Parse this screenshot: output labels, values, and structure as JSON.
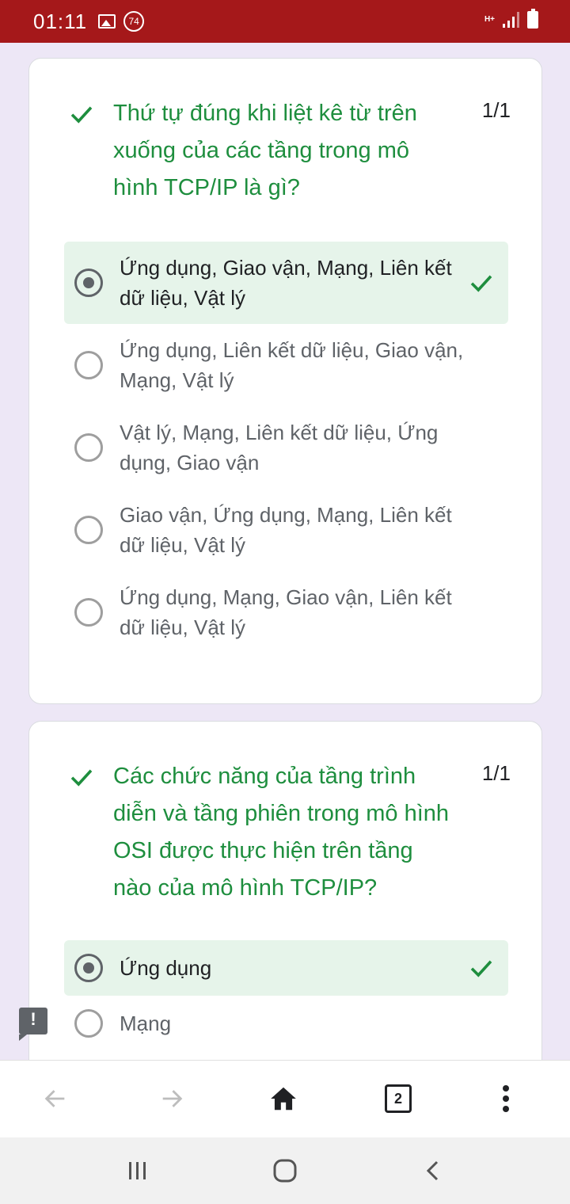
{
  "status_bar": {
    "time": "01:11",
    "notification_badge": "74",
    "network_type": "H+",
    "icons": [
      "image-icon",
      "counter-badge-icon",
      "network-type-icon",
      "signal-icon",
      "battery-icon"
    ]
  },
  "questions": [
    {
      "text": "Thứ tự đúng khi liệt kê từ trên xuống của các tầng trong mô hình TCP/IP là gì?",
      "score": "1/1",
      "options": [
        {
          "label": "Ứng dụng, Giao vận, Mạng, Liên kết dữ liệu, Vật lý",
          "selected": true,
          "correct": true
        },
        {
          "label": "Ứng dụng, Liên kết dữ liệu, Giao vận, Mạng, Vật lý",
          "selected": false,
          "correct": false
        },
        {
          "label": "Vật lý, Mạng, Liên kết dữ liệu, Ứng dụng, Giao vận",
          "selected": false,
          "correct": false
        },
        {
          "label": "Giao vận, Ứng dụng, Mạng, Liên kết dữ liệu, Vật lý",
          "selected": false,
          "correct": false
        },
        {
          "label": "Ứng dụng, Mạng, Giao vận, Liên kết dữ liệu, Vật lý",
          "selected": false,
          "correct": false
        }
      ]
    },
    {
      "text": "Các chức năng của tầng trình diễn và tầng phiên trong mô hình OSI được thực hiện trên tầng nào của mô hình TCP/IP?",
      "score": "1/1",
      "options": [
        {
          "label": "Ứng dụng",
          "selected": true,
          "correct": true
        },
        {
          "label": "Mạng",
          "selected": false,
          "correct": false
        }
      ]
    }
  ],
  "feedback": {
    "symbol": "!"
  },
  "browser_toolbar": {
    "tab_count": "2",
    "buttons": [
      "back-icon",
      "forward-icon",
      "home-icon",
      "tab-switcher",
      "menu-icon"
    ]
  },
  "colors": {
    "status_bar": "#a5181a",
    "page_background": "#ede7f6",
    "correct_green": "#1e8e3e",
    "correct_highlight": "#e6f4ea"
  }
}
